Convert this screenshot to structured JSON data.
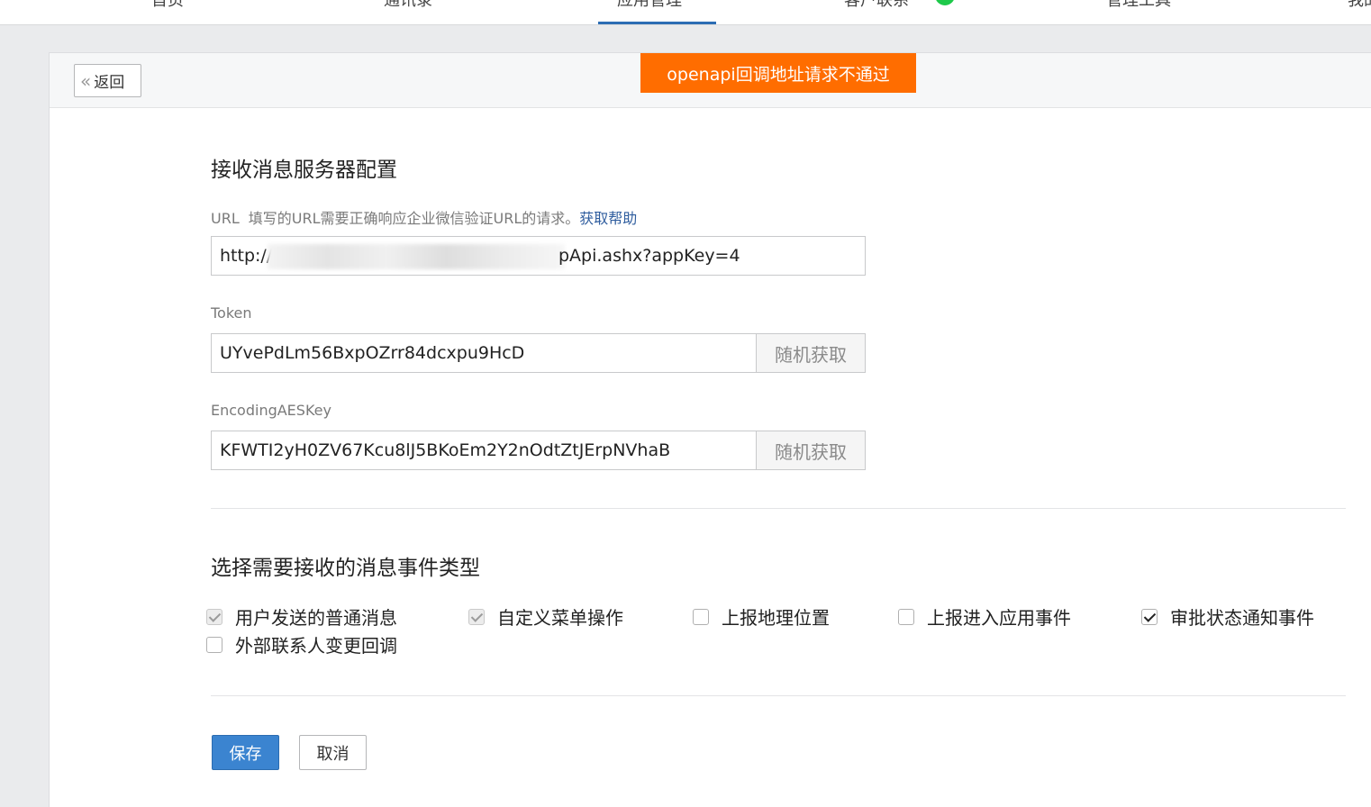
{
  "nav": {
    "items": [
      "首页",
      "通讯录",
      "应用管理",
      "客户联系",
      "管理工具",
      "我的"
    ],
    "active_index": 2
  },
  "header": {
    "back_label": "返回",
    "toast": "openapi回调地址请求不通过"
  },
  "server_config": {
    "title": "接收消息服务器配置",
    "url_label": "URL",
    "url_hint": "填写的URL需要正确响应企业微信验证URL的请求。",
    "url_help": "获取帮助",
    "url_value_prefix": "http://",
    "url_value_suffix": "pApi.ashx?appKey=4",
    "token_label": "Token",
    "token_value": "UYvePdLm56BxpOZrr84dcxpu9HcD",
    "aes_label": "EncodingAESKey",
    "aes_value": "KFWTI2yH0ZV67Kcu8lJ5BKoEm2Y2nOdtZtJErpNVhaB",
    "random_label": "随机获取"
  },
  "events": {
    "title": "选择需要接收的消息事件类型",
    "items": [
      {
        "label": "用户发送的普通消息",
        "checked": true,
        "disabled": true
      },
      {
        "label": "自定义菜单操作",
        "checked": true,
        "disabled": true
      },
      {
        "label": "上报地理位置",
        "checked": false,
        "disabled": false
      },
      {
        "label": "上报进入应用事件",
        "checked": false,
        "disabled": false
      },
      {
        "label": "审批状态通知事件",
        "checked": true,
        "disabled": false
      },
      {
        "label": "外部联系人变更回调",
        "checked": false,
        "disabled": false
      }
    ]
  },
  "footer": {
    "save_label": "保存",
    "cancel_label": "取消"
  },
  "colors": {
    "accent": "#3b84d0",
    "toast": "#ff6d00",
    "nav_active": "#2c6db4"
  }
}
